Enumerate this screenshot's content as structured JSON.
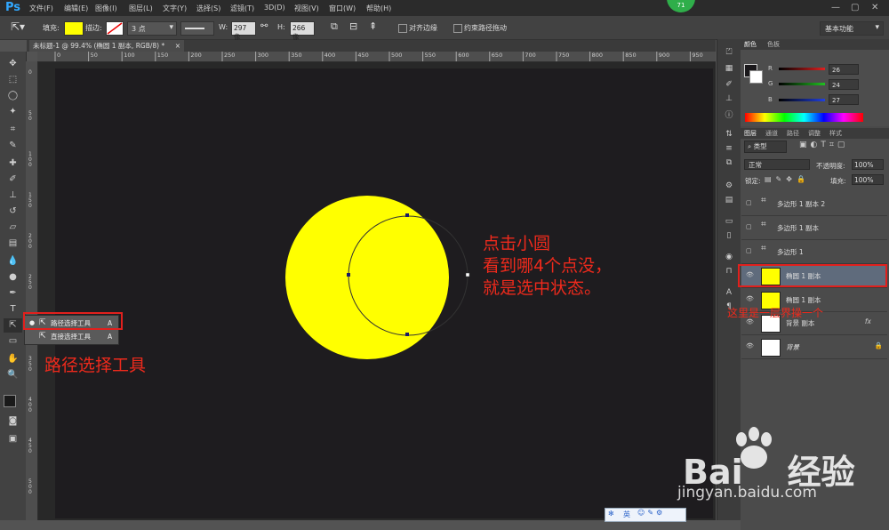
{
  "app": {
    "logo": "Ps",
    "notification_count": "71"
  },
  "menu": [
    "文件(F)",
    "编辑(E)",
    "图像(I)",
    "图层(L)",
    "文字(Y)",
    "选择(S)",
    "滤镜(T)",
    "3D(D)",
    "视图(V)",
    "窗口(W)",
    "帮助(H)"
  ],
  "options_bar": {
    "fill_label": "填充:",
    "stroke_label": "描边:",
    "stroke_size": "3 点",
    "w_label": "W:",
    "w_value": "297 像",
    "link_label": "H:",
    "h_value": "266 像",
    "align_edges": "对齐边缘",
    "constrain_path": "约束路径拖动",
    "workspace": "基本功能",
    "fill_color": "#ffff00"
  },
  "document": {
    "tab_title": "未标题-1 @ 99.4% (椭圆 1 副本, RGB/8) *",
    "close": "×"
  },
  "ruler_h": [
    "0",
    "50",
    "100",
    "150",
    "200",
    "250",
    "300",
    "350",
    "400",
    "450",
    "500",
    "550",
    "600",
    "650",
    "700",
    "750",
    "800",
    "850",
    "900",
    "950",
    "1000"
  ],
  "ruler_v": [
    "0",
    "50",
    "100",
    "150",
    "200",
    "250",
    "300",
    "350",
    "400",
    "450",
    "500"
  ],
  "tool_flyout": {
    "items": [
      {
        "label": "路径选择工具",
        "key": "A"
      },
      {
        "label": "直接选择工具",
        "key": "A"
      }
    ]
  },
  "annotations": {
    "tool_caption": "路径选择工具",
    "canvas_line1": "点击小圆",
    "canvas_line2": "看到哪4个点没，",
    "canvas_line3": "就是选中状态。",
    "layer_note": "这里是一层界操一个"
  },
  "color_panel": {
    "tabs": [
      "颜色",
      "色板"
    ],
    "channels": [
      {
        "label": "R",
        "value": "26",
        "color": "#e02020"
      },
      {
        "label": "G",
        "value": "24",
        "color": "#20c020"
      },
      {
        "label": "B",
        "value": "27",
        "color": "#2040e0"
      }
    ]
  },
  "layers_panel": {
    "tabs": [
      "图层",
      "通道",
      "路径",
      "调整",
      "样式"
    ],
    "filter_kind": "类型",
    "blend_mode": "正常",
    "opacity_label": "不透明度:",
    "opacity_value": "100%",
    "lock_label": "锁定:",
    "fill_label": "填充:",
    "fill_value": "100%",
    "layers": [
      {
        "name": "多边形 1 副本 2",
        "visible": false,
        "kind": "shape"
      },
      {
        "name": "多边形 1 副本",
        "visible": false,
        "kind": "shape"
      },
      {
        "name": "多边形 1",
        "visible": false,
        "kind": "shape"
      },
      {
        "name": "椭圆 1 副本",
        "visible": true,
        "kind": "ellipse",
        "selected": true
      },
      {
        "name": "椭圆 1 副本",
        "visible": true,
        "kind": "ellipse"
      },
      {
        "name": "背景 副本",
        "visible": true,
        "kind": "raster",
        "fx": "fx"
      },
      {
        "name": "背景",
        "visible": true,
        "kind": "raster"
      }
    ]
  },
  "watermark": {
    "brand": "Bai",
    "brand_tail": "经验",
    "url": "jingyan.baidu.com"
  },
  "ime": {
    "label": "英"
  }
}
